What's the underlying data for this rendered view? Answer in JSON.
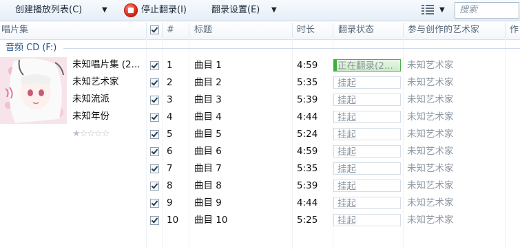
{
  "toolbar": {
    "create_playlist_label": "创建播放列表(C)",
    "stop_rip_label": "停止翻录(I)",
    "rip_settings_label": "翻录设置(E)",
    "search_placeholder": "搜索"
  },
  "columns": {
    "album": "唱片集",
    "number": "#",
    "title": "标题",
    "length": "时长",
    "rip_status": "翻录状态",
    "contributing_artist": "参与创作的艺术家",
    "composer": "作"
  },
  "group": {
    "title": "音频 CD (F:)"
  },
  "album": {
    "name": "未知唱片集 (2...",
    "artist": "未知艺术家",
    "genre": "未知流派",
    "year": "未知年份",
    "rating_stars": "★☆☆☆☆"
  },
  "tracks": [
    {
      "num": "1",
      "title": "曲目 1",
      "length": "4:59",
      "status": "正在翻录(2...",
      "artist": "未知艺术家"
    },
    {
      "num": "2",
      "title": "曲目 2",
      "length": "5:35",
      "status": "挂起",
      "artist": "未知艺术家"
    },
    {
      "num": "3",
      "title": "曲目 3",
      "length": "5:39",
      "status": "挂起",
      "artist": "未知艺术家"
    },
    {
      "num": "4",
      "title": "曲目 4",
      "length": "4:44",
      "status": "挂起",
      "artist": "未知艺术家"
    },
    {
      "num": "5",
      "title": "曲目 5",
      "length": "5:24",
      "status": "挂起",
      "artist": "未知艺术家"
    },
    {
      "num": "6",
      "title": "曲目 6",
      "length": "4:59",
      "status": "挂起",
      "artist": "未知艺术家"
    },
    {
      "num": "7",
      "title": "曲目 7",
      "length": "5:35",
      "status": "挂起",
      "artist": "未知艺术家"
    },
    {
      "num": "8",
      "title": "曲目 8",
      "length": "5:39",
      "status": "挂起",
      "artist": "未知艺术家"
    },
    {
      "num": "9",
      "title": "曲目 9",
      "length": "4:44",
      "status": "挂起",
      "artist": "未知艺术家"
    },
    {
      "num": "10",
      "title": "曲目 10",
      "length": "5:25",
      "status": "挂起",
      "artist": "未知艺术家"
    }
  ],
  "colors": {
    "accent": "#1f4e8c",
    "progress": "#3fae3a",
    "stop": "#d8261a"
  }
}
